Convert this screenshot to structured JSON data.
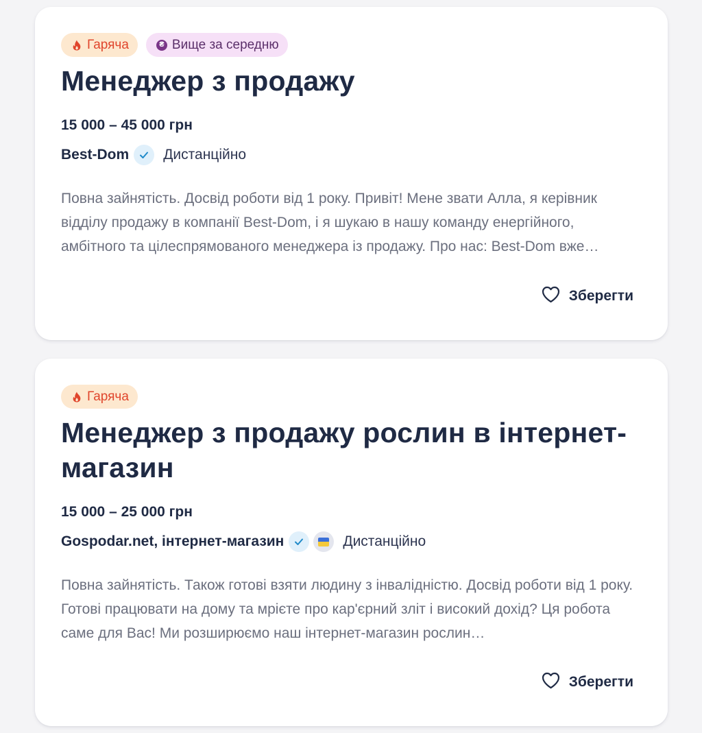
{
  "vacancies": [
    {
      "tags": [
        {
          "label": "Гаряча",
          "icon": "flame-icon",
          "color": "#e0452c"
        },
        {
          "label": "Вище за середню",
          "icon": "coin-icon",
          "color": "#5b2f6a"
        }
      ],
      "title": "Менеджер з продажу",
      "salary": "15 000 – 45 000 грн",
      "company": "Best-Dom",
      "verified": true,
      "location": "Дистанційно",
      "description": "Повна зайнятість. Досвід роботи від 1 року. Привіт! Мене звати Алла, я керівник відділу продажу в компанії Best-Dom, і я шукаю в нашу команду енергійного, амбітного та цілеспрямованого менеджера із продажу. Про нас: Best-Dom вже…",
      "save_label": "Зберегти"
    },
    {
      "tags": [
        {
          "label": "Гаряча",
          "icon": "flame-icon",
          "color": "#e0452c"
        }
      ],
      "title": "Менеджер з продажу рослин в інтернет-магазин",
      "salary": "15 000 – 25 000 грн",
      "company": "Gospodar.net, інтернет-магазин",
      "verified": true,
      "ukraine_badge": true,
      "location": "Дистанційно",
      "description": "Повна зайнятість. Також готові взяти людину з інвалідністю. Досвід роботи від 1 року. Готові працювати на дому та мрієте про кар'єрний зліт і високий дохід? Ця робота саме для Вас! Ми розширюємо наш інтернет-магазин рослин…",
      "save_label": "Зберегти"
    }
  ]
}
